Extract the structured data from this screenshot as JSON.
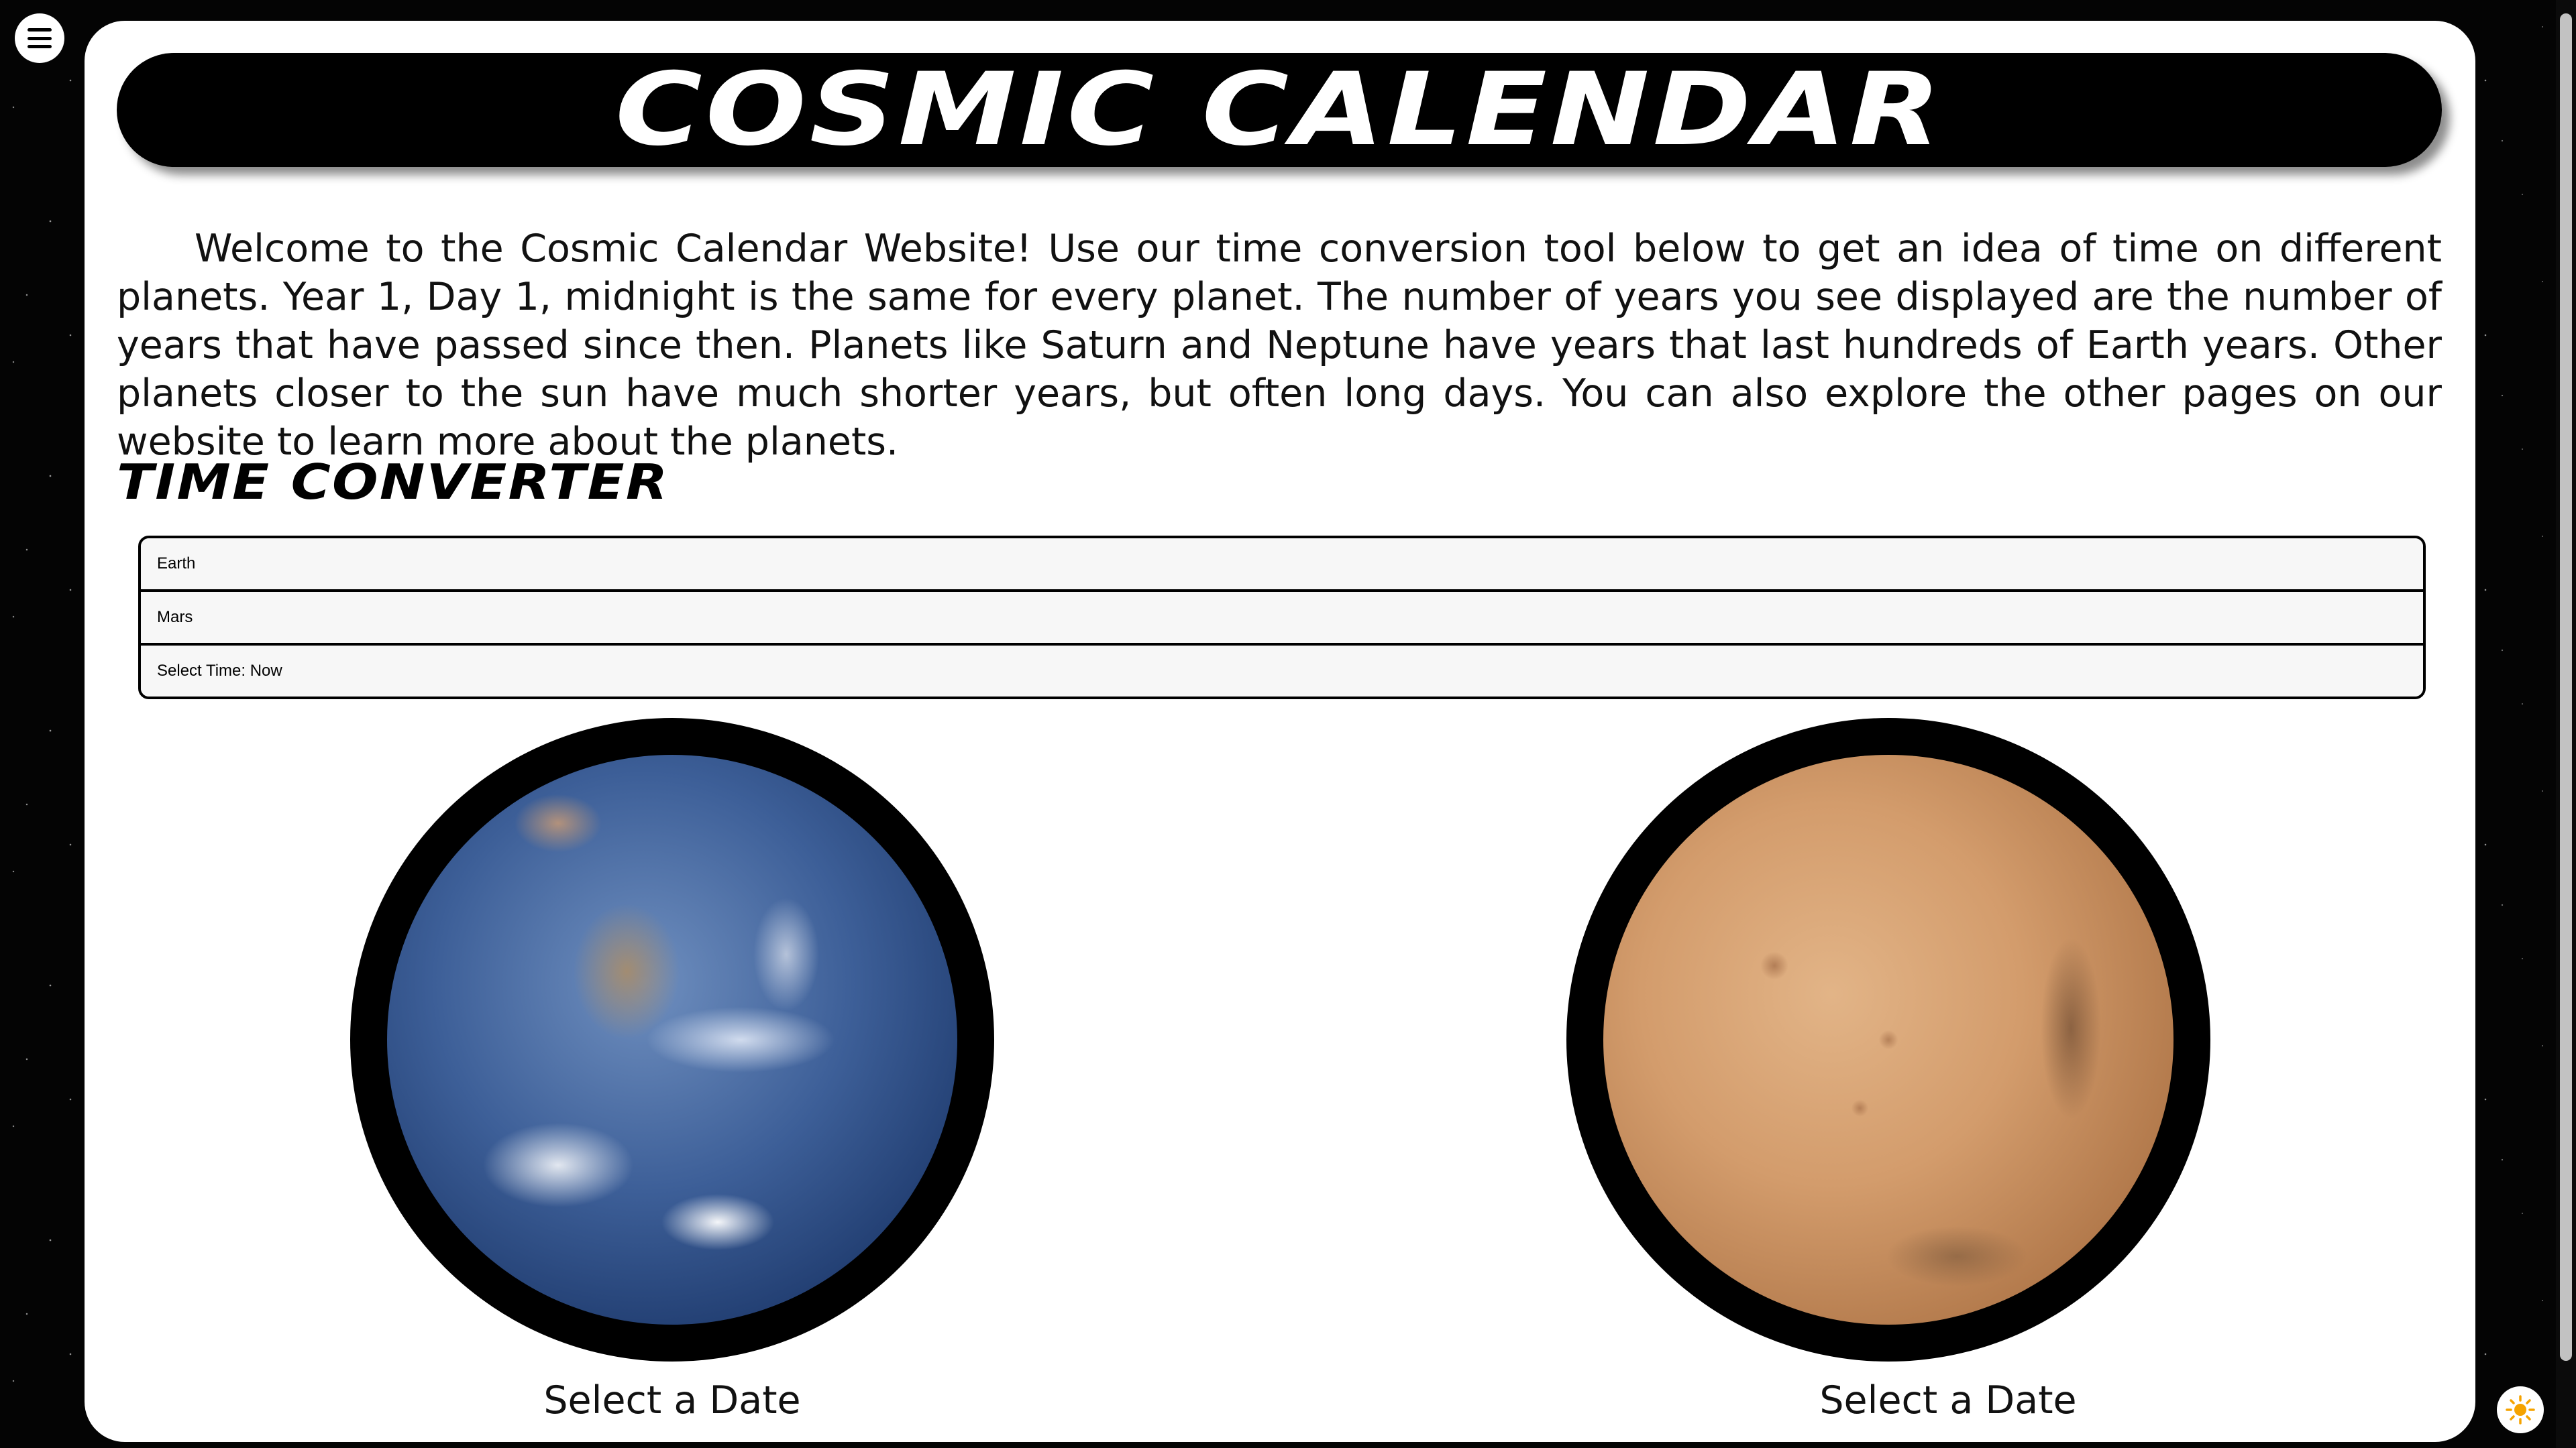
{
  "nav": {
    "menu_icon": "hamburger-menu-icon"
  },
  "header": {
    "title": "Cosmic Calendar"
  },
  "intro": {
    "text": "Welcome to the Cosmic Calendar Website! Use our time conversion tool below to get an idea of time on different planets. Year 1, Day 1, midnight is the same for every planet. The number of years you see displayed are the number of years that have passed since then. Planets like Saturn and Neptune have years that last hundreds of Earth years. Other planets closer to the sun have much shorter years, but often long days. You can also explore the other pages on our website to learn more about the planets."
  },
  "converter": {
    "heading": "Time Converter",
    "planet_a": "Earth",
    "planet_b": "Mars",
    "time_select": "Select Time: Now"
  },
  "planets": {
    "left_caption": "Select a Date",
    "right_caption": "Select a Date"
  },
  "theme_toggle": {
    "icon": "sun-icon",
    "color": "#f5a300"
  }
}
